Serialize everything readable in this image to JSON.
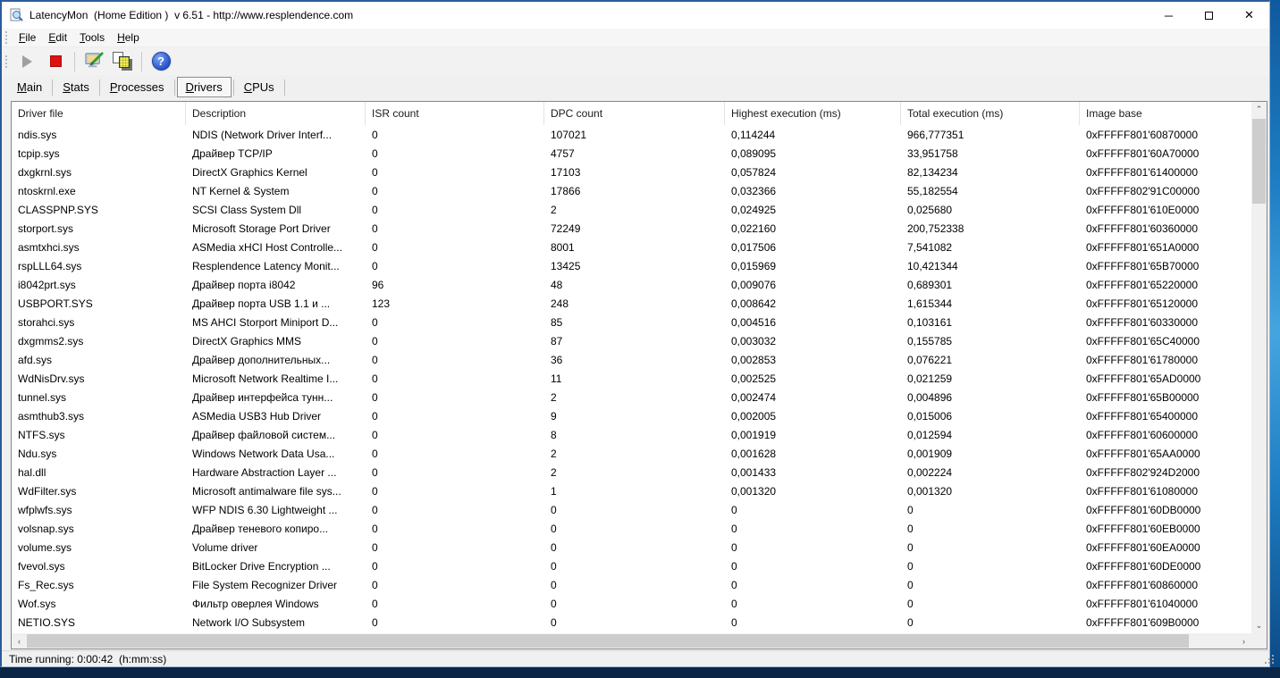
{
  "window": {
    "title": "LatencyMon  (Home Edition )  v 6.51 - http://www.resplendence.com",
    "controls": {
      "minimize": "─",
      "maximize": "",
      "close": "✕"
    }
  },
  "menu": {
    "items": [
      "File",
      "Edit",
      "Tools",
      "Help"
    ]
  },
  "toolbar": {
    "icons": [
      "play-icon",
      "stop-icon",
      "options-icon",
      "copy-icon",
      "help-icon"
    ]
  },
  "tabs": {
    "items": [
      "Main",
      "Stats",
      "Processes",
      "Drivers",
      "CPUs"
    ],
    "selected": "Drivers"
  },
  "table": {
    "columns": [
      "Driver file",
      "Description",
      "ISR count",
      "DPC count",
      "Highest execution (ms)",
      "Total execution (ms)",
      "Image base"
    ],
    "rows": [
      [
        "ndis.sys",
        "NDIS (Network Driver Interf...",
        "0",
        "107021",
        "0,114244",
        "966,777351",
        "0xFFFFF801'60870000"
      ],
      [
        "tcpip.sys",
        "Драйвер TCP/IP",
        "0",
        "4757",
        "0,089095",
        "33,951758",
        "0xFFFFF801'60A70000"
      ],
      [
        "dxgkrnl.sys",
        "DirectX Graphics Kernel",
        "0",
        "17103",
        "0,057824",
        "82,134234",
        "0xFFFFF801'61400000"
      ],
      [
        "ntoskrnl.exe",
        "NT Kernel & System",
        "0",
        "17866",
        "0,032366",
        "55,182554",
        "0xFFFFF802'91C00000"
      ],
      [
        "CLASSPNP.SYS",
        "SCSI Class System Dll",
        "0",
        "2",
        "0,024925",
        "0,025680",
        "0xFFFFF801'610E0000"
      ],
      [
        "storport.sys",
        "Microsoft Storage Port Driver",
        "0",
        "72249",
        "0,022160",
        "200,752338",
        "0xFFFFF801'60360000"
      ],
      [
        "asmtxhci.sys",
        "ASMedia xHCI Host Controlle...",
        "0",
        "8001",
        "0,017506",
        "7,541082",
        "0xFFFFF801'651A0000"
      ],
      [
        "rspLLL64.sys",
        "Resplendence Latency Monit...",
        "0",
        "13425",
        "0,015969",
        "10,421344",
        "0xFFFFF801'65B70000"
      ],
      [
        "i8042prt.sys",
        "Драйвер порта i8042",
        "96",
        "48",
        "0,009076",
        "0,689301",
        "0xFFFFF801'65220000"
      ],
      [
        "USBPORT.SYS",
        "Драйвер порта USB 1.1 и ...",
        "123",
        "248",
        "0,008642",
        "1,615344",
        "0xFFFFF801'65120000"
      ],
      [
        "storahci.sys",
        "MS AHCI Storport Miniport D...",
        "0",
        "85",
        "0,004516",
        "0,103161",
        "0xFFFFF801'60330000"
      ],
      [
        "dxgmms2.sys",
        "DirectX Graphics MMS",
        "0",
        "87",
        "0,003032",
        "0,155785",
        "0xFFFFF801'65C40000"
      ],
      [
        "afd.sys",
        "Драйвер дополнительных...",
        "0",
        "36",
        "0,002853",
        "0,076221",
        "0xFFFFF801'61780000"
      ],
      [
        "WdNisDrv.sys",
        "Microsoft Network Realtime I...",
        "0",
        "11",
        "0,002525",
        "0,021259",
        "0xFFFFF801'65AD0000"
      ],
      [
        "tunnel.sys",
        "Драйвер интерфейса тунн...",
        "0",
        "2",
        "0,002474",
        "0,004896",
        "0xFFFFF801'65B00000"
      ],
      [
        "asmthub3.sys",
        "ASMedia USB3 Hub Driver",
        "0",
        "9",
        "0,002005",
        "0,015006",
        "0xFFFFF801'65400000"
      ],
      [
        "NTFS.sys",
        "Драйвер файловой систем...",
        "0",
        "8",
        "0,001919",
        "0,012594",
        "0xFFFFF801'60600000"
      ],
      [
        "Ndu.sys",
        "Windows Network Data Usa...",
        "0",
        "2",
        "0,001628",
        "0,001909",
        "0xFFFFF801'65AA0000"
      ],
      [
        "hal.dll",
        "Hardware Abstraction Layer ...",
        "0",
        "2",
        "0,001433",
        "0,002224",
        "0xFFFFF802'924D2000"
      ],
      [
        "WdFilter.sys",
        "Microsoft antimalware file sys...",
        "0",
        "1",
        "0,001320",
        "0,001320",
        "0xFFFFF801'61080000"
      ],
      [
        "wfplwfs.sys",
        "WFP NDIS 6.30 Lightweight ...",
        "0",
        "0",
        "0",
        "0",
        "0xFFFFF801'60DB0000"
      ],
      [
        "volsnap.sys",
        "Драйвер теневого копиро...",
        "0",
        "0",
        "0",
        "0",
        "0xFFFFF801'60EB0000"
      ],
      [
        "volume.sys",
        "Volume driver",
        "0",
        "0",
        "0",
        "0",
        "0xFFFFF801'60EA0000"
      ],
      [
        "fvevol.sys",
        "BitLocker Drive Encryption ...",
        "0",
        "0",
        "0",
        "0",
        "0xFFFFF801'60DE0000"
      ],
      [
        "Fs_Rec.sys",
        "File System Recognizer Driver",
        "0",
        "0",
        "0",
        "0",
        "0xFFFFF801'60860000"
      ],
      [
        "Wof.sys",
        "Фильтр оверлея Windows",
        "0",
        "0",
        "0",
        "0",
        "0xFFFFF801'61040000"
      ],
      [
        "NETIO.SYS",
        "Network I/O Subsystem",
        "0",
        "0",
        "0",
        "0",
        "0xFFFFF801'609B0000"
      ]
    ]
  },
  "scrollbars": {
    "up": "▲",
    "down": "▼",
    "left": "◄",
    "right": "►"
  },
  "status_bar": {
    "text": "Time running: 0:00:42  (h:mm:ss)"
  },
  "colors": {
    "stop_red": "#e01111",
    "help_blue": "#2a57cc",
    "window_border_blue": "#2b5b9d",
    "desktop_blue": "#1e7fc4"
  }
}
